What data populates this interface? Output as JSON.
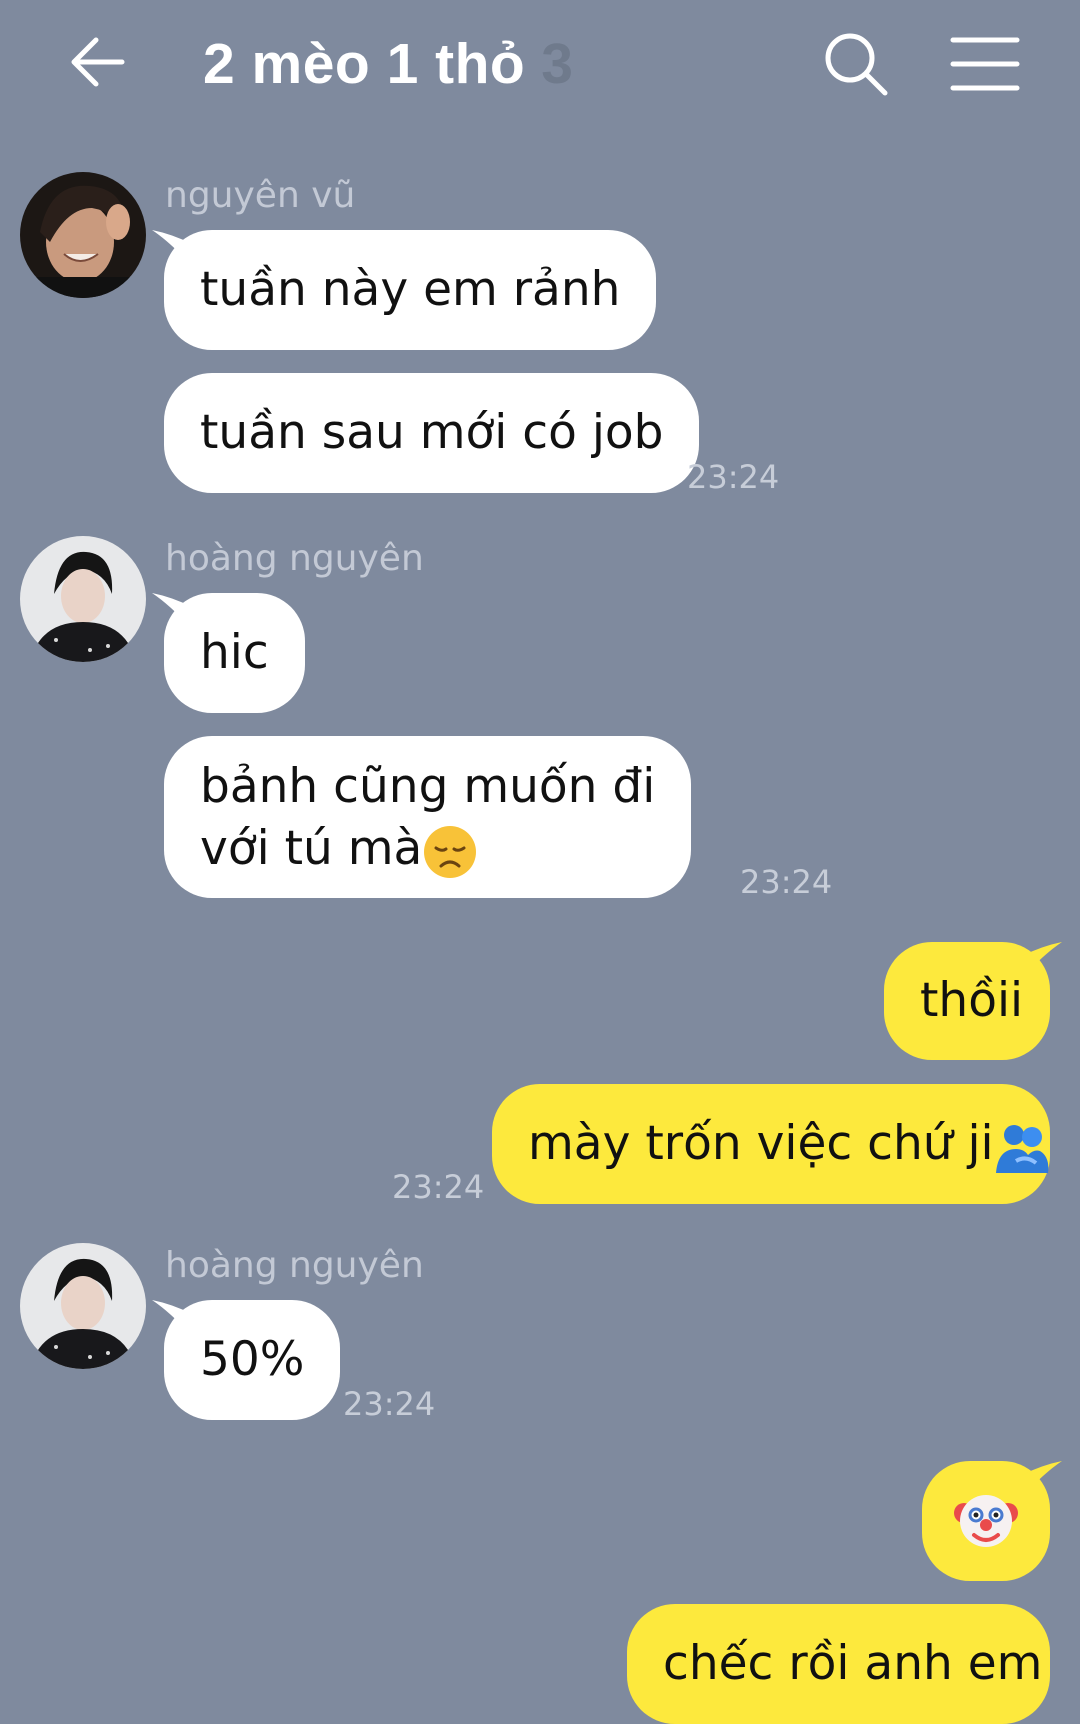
{
  "header": {
    "title": "2 mèo 1 thỏ",
    "member_count": "3",
    "back_icon": "arrow-left-icon",
    "search_icon": "search-icon",
    "menu_icon": "hamburger-menu-icon"
  },
  "colors": {
    "background": "#7f8a9e",
    "incoming_bubble": "#ffffff",
    "outgoing_bubble": "#fde93d"
  },
  "messages": [
    {
      "sender": "nguyên vũ",
      "direction": "incoming",
      "bubbles": [
        "tuần này em rảnh",
        "tuần sau mới có job"
      ],
      "time": "23:24"
    },
    {
      "sender": "hoàng nguyên",
      "direction": "incoming",
      "bubbles": [
        "hic",
        "bảnh cũng muốn đi",
        "với tú mà"
      ],
      "emoji": "disappointed-face-emoji",
      "time": "23:24"
    },
    {
      "sender": "me",
      "direction": "outgoing",
      "bubbles": [
        "thồii",
        "mày trốn việc chứ ji"
      ],
      "emoji": "people-hugging-emoji",
      "time": "23:24"
    },
    {
      "sender": "hoàng nguyên",
      "direction": "incoming",
      "bubbles": [
        "50%"
      ],
      "time": "23:24"
    },
    {
      "sender": "me",
      "direction": "outgoing",
      "bubbles": [
        "🤡",
        "chếc rồi anh em"
      ],
      "emoji": "clown-face-emoji"
    }
  ]
}
